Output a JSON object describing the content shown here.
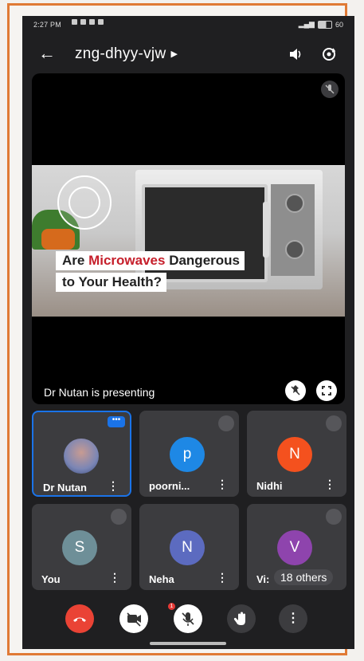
{
  "status": {
    "time": "2:27 PM",
    "battery": "60"
  },
  "header": {
    "meeting_code": "zng-dhyy-vjw"
  },
  "slide": {
    "line1_a": "Are ",
    "line1_b": "Microwaves",
    "line1_c": " Dangerous",
    "line2": "to Your Health?"
  },
  "stage": {
    "presenting_text": "Dr Nutan is presenting"
  },
  "participants": [
    {
      "name": "Dr Nutan",
      "initial": "",
      "color": "#7b86b5"
    },
    {
      "name": "poorni...",
      "initial": "p",
      "color": "#1e88e5"
    },
    {
      "name": "Nidhi",
      "initial": "N",
      "color": "#f4511e"
    },
    {
      "name": "You",
      "initial": "S",
      "color": "#6e8f98"
    },
    {
      "name": "Neha",
      "initial": "N",
      "color": "#5c6bc0"
    },
    {
      "name": "Vi:",
      "initial": "V",
      "color": "#8e44ad",
      "others": "18 others"
    }
  ],
  "controls": {
    "chat_badge": "1"
  },
  "colors": {
    "accent": "#1a73e8",
    "end_call": "#ea4335",
    "frame": "#e07a35"
  }
}
